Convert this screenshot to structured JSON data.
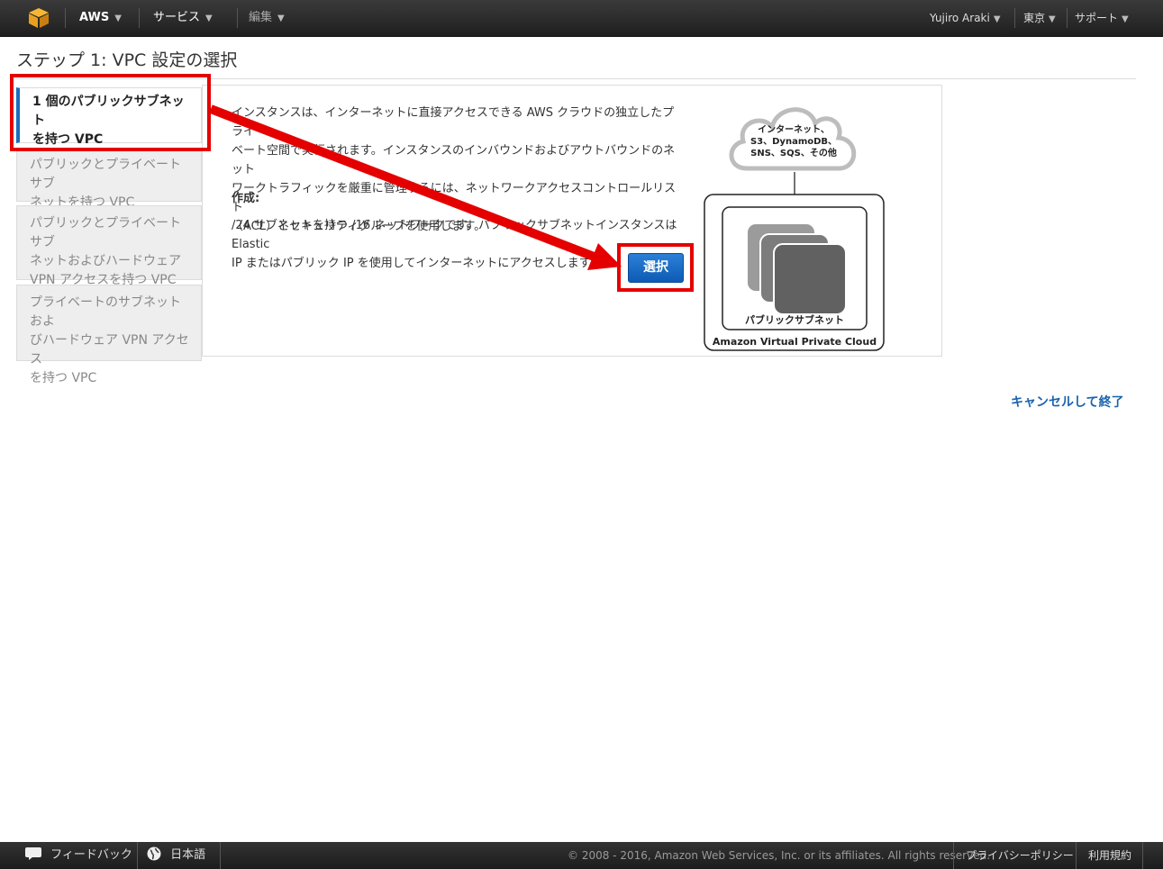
{
  "nav": {
    "aws_label": "AWS",
    "services_label": "サービス",
    "edit_label": "編集",
    "user_label": "Yujiro Araki",
    "region_label": "東京",
    "support_label": "サポート"
  },
  "page": {
    "title": "ステップ 1: VPC 設定の選択"
  },
  "tabs": [
    {
      "label": "1 個のパブリックサブネットを持つ VPC",
      "line1": "1 個のパブリックサブネット",
      "line2": "を持つ VPC"
    },
    {
      "line1": "パブリックとプライベート サブ",
      "line2": "ネットを持つ VPC"
    },
    {
      "line1": "パブリックとプライベート サブ",
      "line2": "ネットおよびハードウェア",
      "line3": "VPN アクセスを持つ VPC"
    },
    {
      "line1": "プライベートのサブネットおよ",
      "line2": "びハードウェア VPN アクセス",
      "line3": "を持つ VPC"
    }
  ],
  "panel": {
    "desc_line1": "インスタンスは、インターネットに直接アクセスできる AWS クラウドの独立したプライ",
    "desc_line2": "ベート空間で実行されます。インスタンスのインバウンドおよびアウトバウンドのネット",
    "desc_line3": "ワークトラフィックを厳重に管理するには、ネットワークアクセスコントロールリスト",
    "desc_line4": "（ACL）とセキュリティグループを使用します。",
    "create_label": "作成:",
    "create_line1": "/24 サブネットを持つ /16 ネットワークです。パブリックサブネットインスタンスは Elastic",
    "create_line2": "IP またはパブリック IP を使用してインターネットにアクセスします。",
    "select_button": "選択"
  },
  "diagram": {
    "cloud_line1": "インターネット、",
    "cloud_line2": "S3、DynamoDB、",
    "cloud_line3": "SNS、SQS、その他",
    "subnet_label": "パブリックサブネット",
    "vpc_label": "Amazon Virtual Private Cloud"
  },
  "cancel_link": "キャンセルして終了",
  "footer": {
    "feedback": "フィードバック",
    "language": "日本語",
    "copyright": "© 2008 - 2016, Amazon Web Services, Inc. or its affiliates. All rights reserved.",
    "privacy": "プライバシーポリシー",
    "terms": "利用規約"
  },
  "colors": {
    "accent_red": "#e50000",
    "button_blue": "#0d5bb5",
    "link_blue": "#1a63ad"
  }
}
